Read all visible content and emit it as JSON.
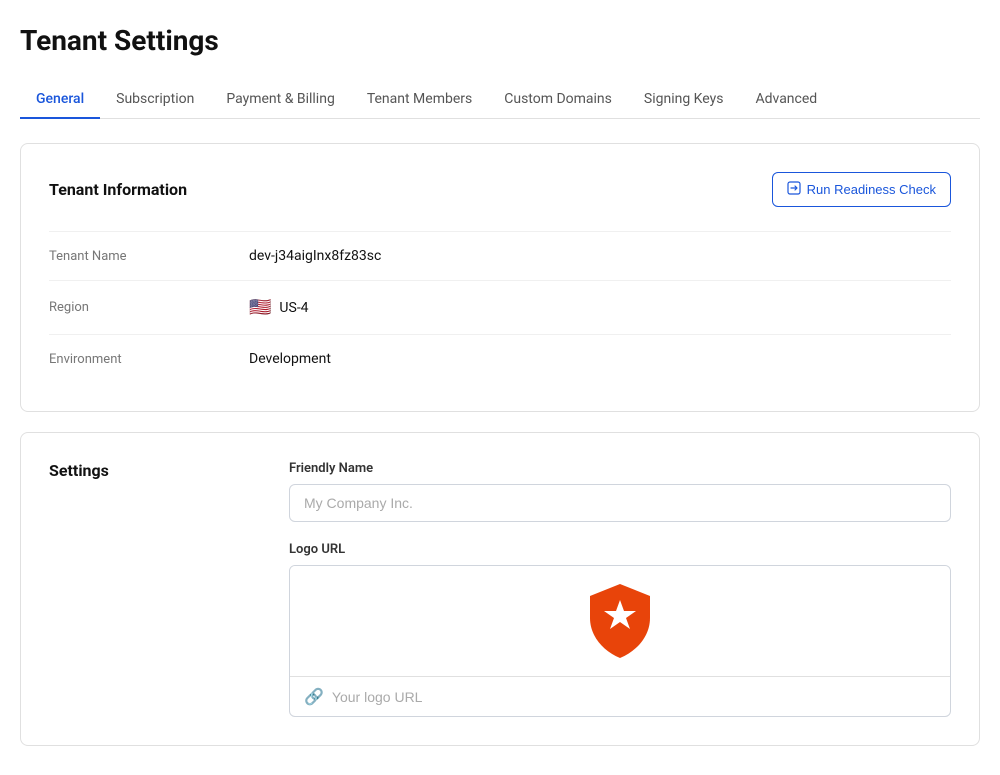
{
  "page": {
    "title": "Tenant Settings"
  },
  "tabs": {
    "items": [
      {
        "id": "general",
        "label": "General",
        "active": true
      },
      {
        "id": "subscription",
        "label": "Subscription",
        "active": false
      },
      {
        "id": "payment-billing",
        "label": "Payment & Billing",
        "active": false
      },
      {
        "id": "tenant-members",
        "label": "Tenant Members",
        "active": false
      },
      {
        "id": "custom-domains",
        "label": "Custom Domains",
        "active": false
      },
      {
        "id": "signing-keys",
        "label": "Signing Keys",
        "active": false
      },
      {
        "id": "advanced",
        "label": "Advanced",
        "active": false
      }
    ]
  },
  "tenant_info": {
    "section_title": "Tenant Information",
    "readiness_button": "Run Readiness Check",
    "fields": [
      {
        "label": "Tenant Name",
        "value": "dev-j34aigInx8fz83sc",
        "has_flag": false
      },
      {
        "label": "Region",
        "value": "US-4",
        "has_flag": true
      },
      {
        "label": "Environment",
        "value": "Development",
        "has_flag": false
      }
    ]
  },
  "settings": {
    "section_title": "Settings",
    "friendly_name": {
      "label": "Friendly Name",
      "placeholder": "My Company Inc.",
      "value": ""
    },
    "logo_url": {
      "label": "Logo URL",
      "placeholder": "Your logo URL",
      "value": ""
    }
  },
  "icons": {
    "external_link": "↗",
    "link": "🔗",
    "flag_us": "🇺🇸"
  }
}
